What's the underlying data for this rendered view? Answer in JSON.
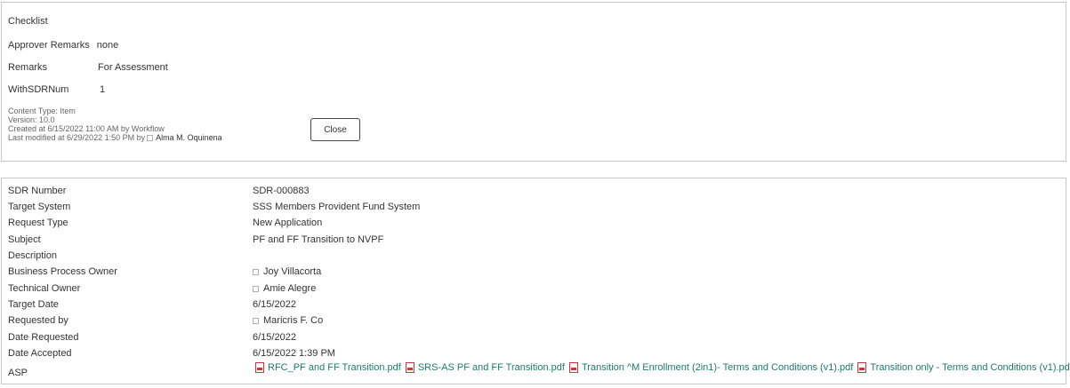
{
  "item": {
    "checklist_label": "Checklist",
    "approver_remarks_label": "Approver Remarks",
    "approver_remarks_value": "none",
    "remarks_label": "Remarks",
    "remarks_value": "For Assessment",
    "withsdrnum_label": "WithSDRNum",
    "withsdrnum_value": "1",
    "content_type": "Content Type: Item",
    "version": "Version: 10.0",
    "created": "Created at 6/15/2022 11:00 AM  by Workflow",
    "modified_prefix": "Last modified at 6/29/2022 1:50 PM  by",
    "modified_by": "Alma M. Oquinena",
    "close_label": "Close"
  },
  "sdr": {
    "rows": [
      {
        "label": "SDR Number",
        "value": "SDR-000883"
      },
      {
        "label": "Target System",
        "value": "SSS Members Provident Fund System"
      },
      {
        "label": "Request Type",
        "value": "New Application"
      },
      {
        "label": "Subject",
        "value": "PF and FF Transition to NVPF"
      },
      {
        "label": "Description",
        "value": ""
      },
      {
        "label": "Business Process Owner",
        "value": "Joy Villacorta"
      },
      {
        "label": "Technical Owner",
        "value": "Amie Alegre"
      },
      {
        "label": "Target Date",
        "value": "6/15/2022"
      },
      {
        "label": "Requested by",
        "value": "Maricris F. Co"
      },
      {
        "label": "Date Requested",
        "value": "6/15/2022"
      },
      {
        "label": "Date Accepted",
        "value": "6/15/2022 1:39 PM"
      },
      {
        "label": "ASP",
        "value": ""
      }
    ],
    "attachments": [
      "RFC_PF and FF Transition.pdf",
      "SRS-AS PF and FF Transition.pdf",
      "Transition ^M Enrollment (2in1)- Terms and Conditions (v1).pdf",
      "Transition only - Terms and Conditions (v1).pdf"
    ]
  },
  "colors": {
    "link": "#1e7a6e",
    "pdf_icon": "#c43b3b",
    "border": "#c8c8c8"
  }
}
